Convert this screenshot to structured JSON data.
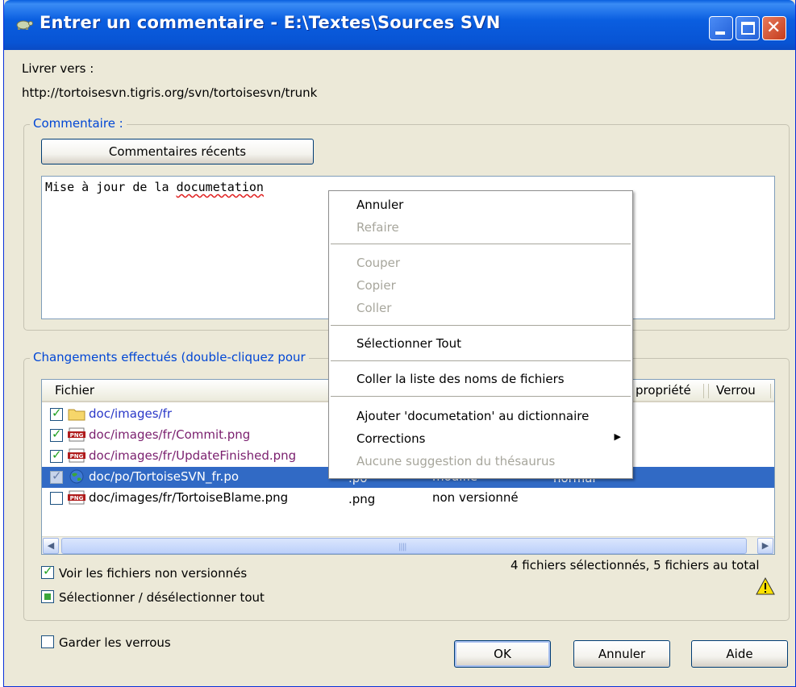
{
  "window": {
    "title": "Entrer un commentaire - E:\\Textes\\Sources SVN",
    "controls": {
      "minimize": "minimize-icon",
      "maximize": "maximize-icon",
      "close": "close-icon"
    }
  },
  "commit_target": {
    "label": "Livrer vers :",
    "url": "http://tortoisesvn.tigris.org/svn/tortoisesvn/trunk"
  },
  "comment_group": {
    "legend": "Commentaire :",
    "recent_button": "Commentaires récents",
    "text_before": "Mise à jour de la ",
    "text_misspelled": "documetation"
  },
  "context_menu": {
    "undo": "Annuler",
    "redo": "Refaire",
    "cut": "Couper",
    "copy": "Copier",
    "paste": "Coller",
    "select_all": "Sélectionner Tout",
    "paste_filenames": "Coller la liste des noms de fichiers",
    "add_dictionary": "Ajouter 'documetation' au dictionnaire",
    "corrections": "Corrections",
    "no_thesaurus": "Aucune suggestion du thésaurus"
  },
  "changes_group": {
    "legend": "Changements effectués (double-cliquez pour",
    "columns": {
      "file": "Fichier",
      "property": "propriété",
      "lock": "Verrou"
    },
    "rows": [
      {
        "name": "doc/images/fr",
        "ext": "",
        "status": "",
        "prop": "",
        "checked": true,
        "icon": "folder-icon"
      },
      {
        "name": "doc/images/fr/Commit.png",
        "ext": "",
        "status": "",
        "prop": "",
        "checked": true,
        "icon": "png-file-icon"
      },
      {
        "name": "doc/images/fr/UpdateFinished.png",
        "ext": "",
        "status": "",
        "prop": "",
        "checked": true,
        "icon": "png-file-icon"
      },
      {
        "name": "doc/po/TortoiseSVN_fr.po",
        "ext": ".po",
        "status": "modifié",
        "prop": "normal",
        "checked": true,
        "icon": "globe-icon"
      },
      {
        "name": "doc/images/fr/TortoiseBlame.png",
        "ext": ".png",
        "status": "non versionné",
        "prop": "",
        "checked": false,
        "icon": "png-file-icon"
      }
    ],
    "show_unversioned": "Voir les fichiers non versionnés",
    "select_all": "Sélectionner / désélectionner tout",
    "summary": "4 fichiers sélectionnés, 5 fichiers au total"
  },
  "keep_locks": "Garder les verrous",
  "buttons": {
    "ok": "OK",
    "cancel": "Annuler",
    "help": "Aide"
  }
}
